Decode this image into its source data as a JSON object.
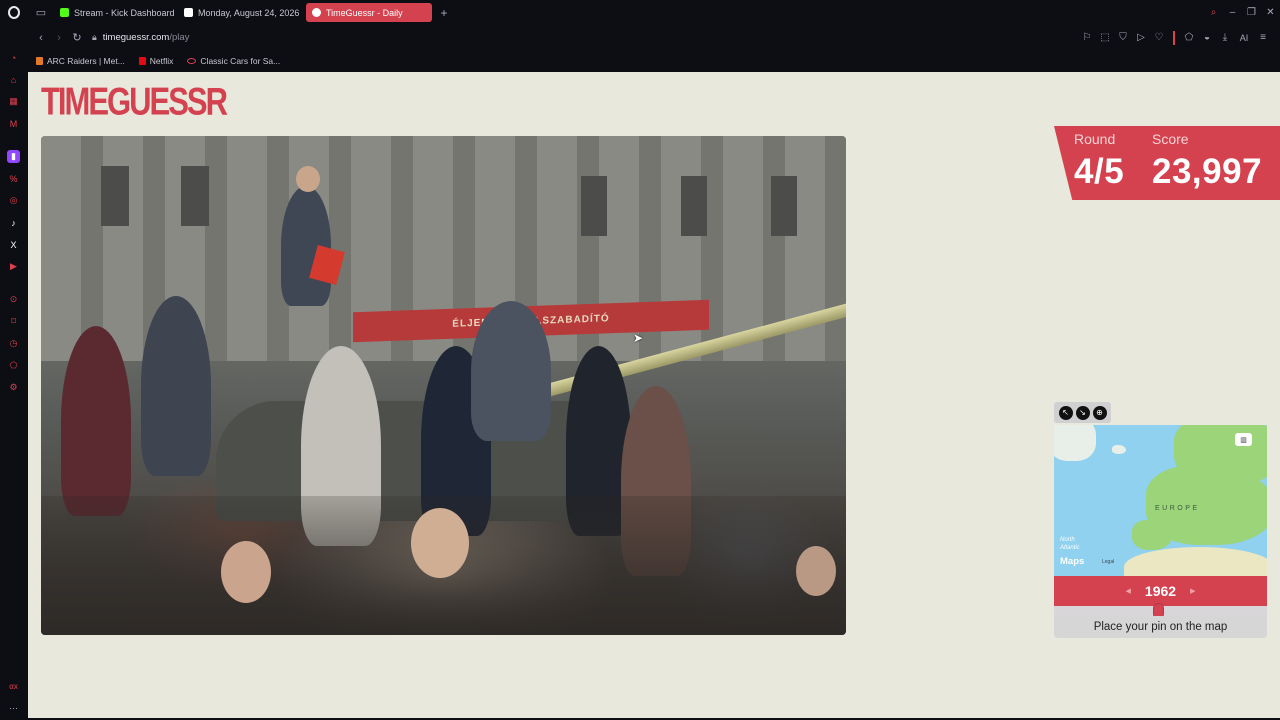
{
  "browser": {
    "tabs": [
      {
        "label": "Stream - Kick Dashboard",
        "favicon_color": "#53fc18",
        "active": false
      },
      {
        "label": "Monday, August 24, 2026",
        "favicon_color": "#ffffff",
        "active": false
      },
      {
        "label": "TimeGuessr - Daily",
        "favicon_color": "#ffffff",
        "active": true
      }
    ],
    "new_tab": "+",
    "url_host": "timeguessr.com",
    "url_path": "/play",
    "ai_label": "AI",
    "bookmarks": [
      {
        "label": "ARC Raiders | Met...",
        "color": "#e07a2a"
      },
      {
        "label": "Netflix",
        "color": "#e50914"
      },
      {
        "label": "Classic Cars for Sa...",
        "color": "#e0404d"
      }
    ],
    "sidebar_ax": "αx"
  },
  "game": {
    "logo": "TIMEGUESSR",
    "banner_text": "ÉLJENEK A FELSZABADÍTÓ",
    "round_label": "Round",
    "round_value": "4/5",
    "score_label": "Score",
    "score_value": "23,997",
    "map": {
      "region_label": "EUROPE",
      "ocean_label_1": "North",
      "ocean_label_2": "Atlantic",
      "brand": "Maps",
      "legal": "Legal"
    },
    "year": "1962",
    "year_fraction": 0.49,
    "pin_prompt": "Place your pin on the map",
    "accent_color": "#d4424f"
  }
}
